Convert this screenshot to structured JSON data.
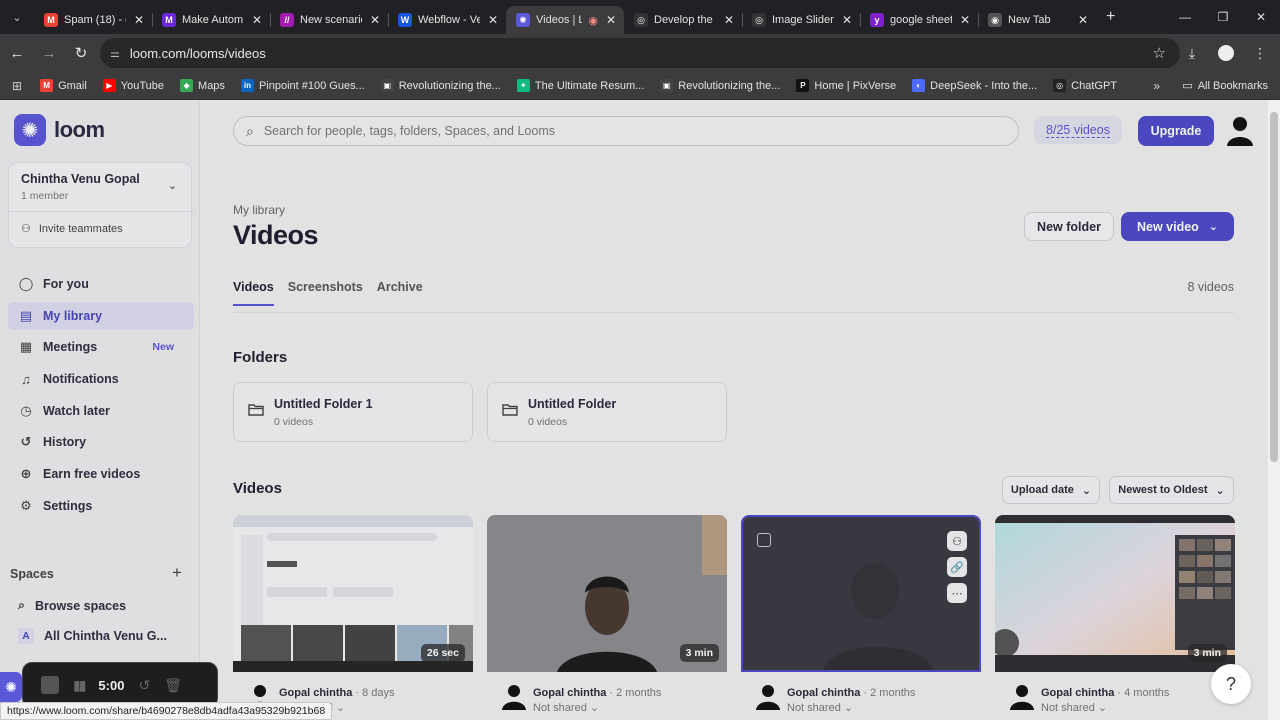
{
  "browser": {
    "tabs": [
      {
        "label": "Spam (18) - c",
        "fav": "M",
        "color": "#ea4335"
      },
      {
        "label": "Make Autom",
        "fav": "M",
        "color": "#6d28d9"
      },
      {
        "label": "New scenario",
        "fav": "//",
        "color": "#a21caf"
      },
      {
        "label": "Webflow - Ve",
        "fav": "W",
        "color": "#1a56db"
      },
      {
        "label": "Videos | L",
        "fav": "✺",
        "color": "#5b57d9"
      },
      {
        "label": "Develop the",
        "fav": "◎",
        "color": "#333"
      },
      {
        "label": "Image Slider",
        "fav": "◎",
        "color": "#333"
      },
      {
        "label": "google sheet",
        "fav": "y",
        "color": "#7e22ce"
      },
      {
        "label": "New Tab",
        "fav": "◉",
        "color": "#555"
      }
    ],
    "url": "loom.com/looms/videos",
    "bookmarks": [
      {
        "label": "Gmail",
        "fav": "M",
        "color": "#ea4335"
      },
      {
        "label": "YouTube",
        "fav": "▶",
        "color": "#ff0000"
      },
      {
        "label": "Maps",
        "fav": "◆",
        "color": "#34a853"
      },
      {
        "label": "Pinpoint #100 Gues...",
        "fav": "in",
        "color": "#0a66c2"
      },
      {
        "label": "Revolutionizing the...",
        "fav": "▣",
        "color": "#444"
      },
      {
        "label": "The Ultimate Resum...",
        "fav": "✦",
        "color": "#10b981"
      },
      {
        "label": "Revolutionizing the...",
        "fav": "▣",
        "color": "#444"
      },
      {
        "label": "Home | PixVerse",
        "fav": "P",
        "color": "#111"
      },
      {
        "label": "DeepSeek - Into the...",
        "fav": "◐",
        "color": "#4d6bfe"
      },
      {
        "label": "ChatGPT",
        "fav": "◎",
        "color": "#222"
      }
    ],
    "all_bookmarks": "All Bookmarks",
    "status_url": "https://www.loom.com/share/b4690278e8db4adfa43a95329b921b68"
  },
  "sidebar": {
    "logo": "loom",
    "workspace_name": "Chintha Venu Gopal",
    "workspace_members": "1 member",
    "invite": "Invite teammates",
    "nav": [
      {
        "label": "For you",
        "icon": "user-circle-icon",
        "glyph": "◯",
        "active": false
      },
      {
        "label": "My library",
        "icon": "library-icon",
        "glyph": "▤",
        "active": true
      },
      {
        "label": "Meetings",
        "icon": "calendar-icon",
        "glyph": "▦",
        "active": false,
        "badge": "New"
      },
      {
        "label": "Notifications",
        "icon": "bell-icon",
        "glyph": "♫",
        "active": false
      },
      {
        "label": "Watch later",
        "icon": "clock-icon",
        "glyph": "◷",
        "active": false
      },
      {
        "label": "History",
        "icon": "history-icon",
        "glyph": "↺",
        "active": false
      },
      {
        "label": "Earn free videos",
        "icon": "gift-icon",
        "glyph": "⊕",
        "active": false
      },
      {
        "label": "Settings",
        "icon": "gear-icon",
        "glyph": "⚙",
        "active": false
      }
    ],
    "spaces_heading": "Spaces",
    "browse_spaces": "Browse spaces",
    "all_space": "All Chintha Venu G...",
    "all_space_badge": "A"
  },
  "topbar": {
    "search_placeholder": "Search for people, tags, folders, Spaces, and Looms",
    "quota": "8/25 videos",
    "upgrade": "Upgrade"
  },
  "main": {
    "breadcrumb": "My library",
    "title": "Videos",
    "new_folder": "New folder",
    "new_video": "New video",
    "tabs": [
      "Videos",
      "Screenshots",
      "Archive"
    ],
    "video_count": "8 videos",
    "folders_heading": "Folders",
    "folders": [
      {
        "name": "Untitled Folder 1",
        "count": "0 videos"
      },
      {
        "name": "Untitled Folder",
        "count": "0 videos"
      }
    ],
    "videos_heading": "Videos",
    "sort_field": "Upload date",
    "sort_order": "Newest to Oldest",
    "videos": [
      {
        "duration": "26 sec",
        "owner": "Gopal chintha",
        "time": "8 days",
        "share": "Not shared"
      },
      {
        "duration": "3 min",
        "owner": "Gopal chintha",
        "time": "2 months",
        "share": "Not shared"
      },
      {
        "duration": "",
        "owner": "Gopal chintha",
        "time": "2 months",
        "share": "Not shared"
      },
      {
        "duration": "3 min",
        "owner": "Gopal chintha",
        "time": "4 months",
        "share": "Not shared"
      }
    ]
  },
  "recorder": {
    "time": "5:00"
  },
  "help": "?",
  "colors": {
    "accent": "#5b57d9",
    "button": "#4e4ac8"
  }
}
